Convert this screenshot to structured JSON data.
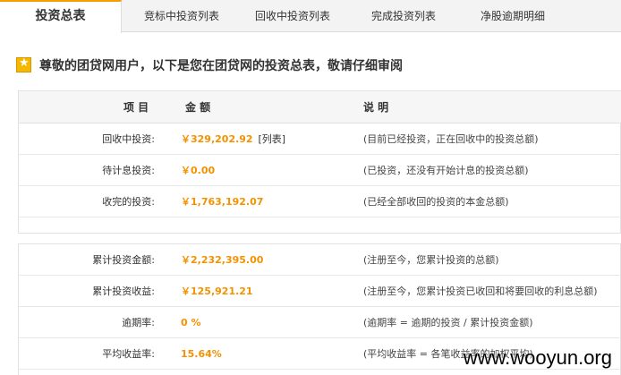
{
  "tabs": [
    {
      "label": "投资总表",
      "active": true
    },
    {
      "label": "竞标中投资列表",
      "active": false
    },
    {
      "label": "回收中投资列表",
      "active": false
    },
    {
      "label": "完成投资列表",
      "active": false
    },
    {
      "label": "净股逾期明细",
      "active": false
    }
  ],
  "header": {
    "icon": "star-icon",
    "text": "尊敬的团贷网用户，以下是您在团贷网的投资总表，敬请仔细审阅"
  },
  "table_headers": {
    "item": "项 目",
    "amount": "金 额",
    "note": "说 明"
  },
  "section1": [
    {
      "label": "回收中投资:",
      "value": "￥329,202.92",
      "link": "[列表]",
      "note": "(目前已经投资，正在回收中的投资总额)"
    },
    {
      "label": "待计息投资:",
      "value": "￥0.00",
      "note": "(已投资，还没有开始计息的投资总额)"
    },
    {
      "label": "收完的投资:",
      "value": "￥1,763,192.07",
      "note": "(已经全部收回的投资的本金总额)"
    }
  ],
  "section2": [
    {
      "label": "累计投资金额:",
      "value": "￥2,232,395.00",
      "note": "(注册至今，您累计投资的总额)"
    },
    {
      "label": "累计投资收益:",
      "value": "￥125,921.21",
      "note": "(注册至今，您累计投资已收回和将要回收的利息总额)"
    },
    {
      "label": "逾期率:",
      "value": "0 %",
      "note": "(逾期率 = 逾期的投资 / 累计投资金额)"
    },
    {
      "label": "平均收益率:",
      "value": "15.64%",
      "note": "(平均收益率 = 各笔收益率的加权平均)"
    }
  ],
  "watermark": "www.wooyun.org",
  "colors": {
    "accent": "#f39200",
    "tab_active_border": "#f3a000",
    "tab_bar": "#f3f3f3",
    "header_bg": "#f6f6f6"
  }
}
